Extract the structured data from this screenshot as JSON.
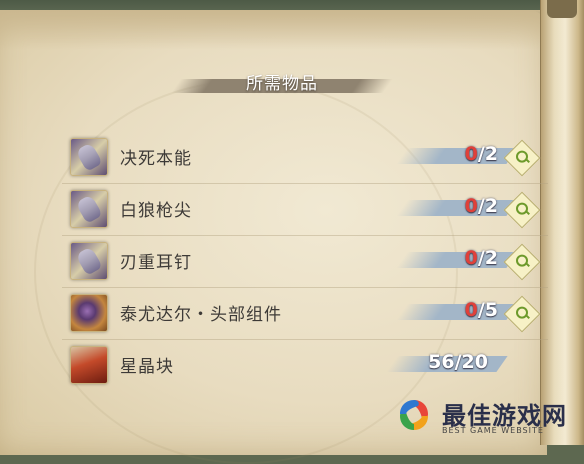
{
  "panel": {
    "title": "所需物品"
  },
  "items": [
    {
      "name": "决死本能",
      "have": "0",
      "need": "2",
      "icon": "relic-purple-icon",
      "sufficient": false,
      "has_search": true
    },
    {
      "name": "白狼枪尖",
      "have": "0",
      "need": "2",
      "icon": "relic-spear-icon",
      "sufficient": false,
      "has_search": true
    },
    {
      "name": "刃重耳钉",
      "have": "0",
      "need": "2",
      "icon": "relic-earring-icon",
      "sufficient": false,
      "has_search": true
    },
    {
      "name": "泰尤达尔・头部组件",
      "have": "0",
      "need": "5",
      "icon": "relic-orb-icon",
      "sufficient": false,
      "has_search": true
    },
    {
      "name": "星晶块",
      "have": "56",
      "need": "20",
      "icon": "star-crystal-ore-icon",
      "sufficient": true,
      "has_search": false
    }
  ],
  "watermark": {
    "text": "最佳游戏网",
    "subtext": "BEST GAME WEBSITE"
  },
  "colors": {
    "insufficient": "#e0403a",
    "count_bar": "#a3b6c8",
    "parchment": "#ece2c8",
    "search_icon": "#6d9a2b"
  }
}
